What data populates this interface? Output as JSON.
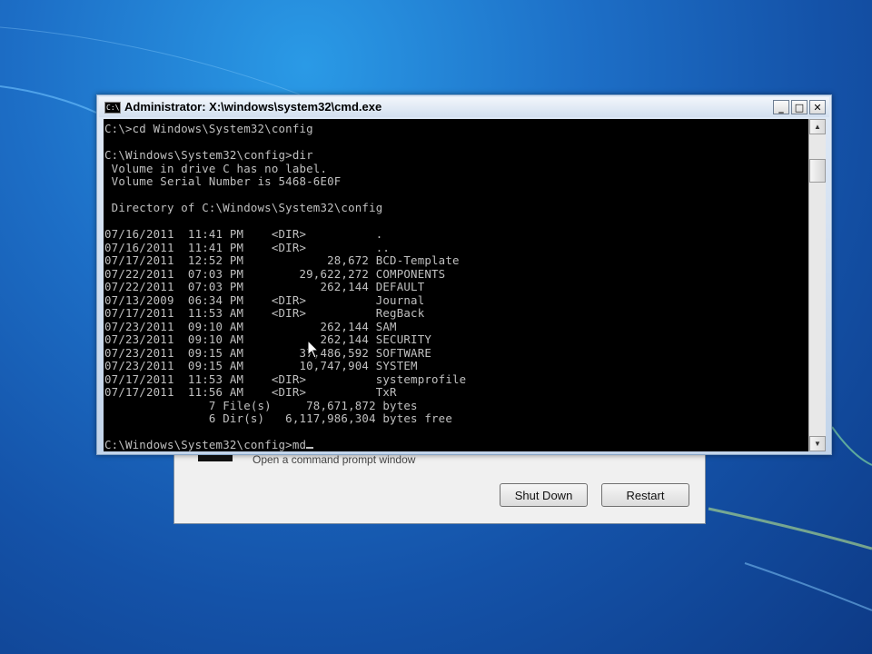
{
  "window": {
    "title": "Administrator: X:\\windows\\system32\\cmd.exe",
    "icon_label": "C:\\",
    "controls": {
      "minimize": "_",
      "maximize": "□",
      "close": "✕"
    }
  },
  "console": {
    "lines": [
      "C:\\>cd Windows\\System32\\config",
      "",
      "C:\\Windows\\System32\\config>dir",
      " Volume in drive C has no label.",
      " Volume Serial Number is 5468-6E0F",
      "",
      " Directory of C:\\Windows\\System32\\config",
      "",
      "07/16/2011  11:41 PM    <DIR>          .",
      "07/16/2011  11:41 PM    <DIR>          ..",
      "07/17/2011  12:52 PM            28,672 BCD-Template",
      "07/22/2011  07:03 PM        29,622,272 COMPONENTS",
      "07/22/2011  07:03 PM           262,144 DEFAULT",
      "07/13/2009  06:34 PM    <DIR>          Journal",
      "07/17/2011  11:53 AM    <DIR>          RegBack",
      "07/23/2011  09:10 AM           262,144 SAM",
      "07/23/2011  09:10 AM           262,144 SECURITY",
      "07/23/2011  09:15 AM        37,486,592 SOFTWARE",
      "07/23/2011  09:15 AM        10,747,904 SYSTEM",
      "07/17/2011  11:53 AM    <DIR>          systemprofile",
      "07/17/2011  11:56 AM    <DIR>          TxR",
      "               7 File(s)     78,671,872 bytes",
      "               6 Dir(s)   6,117,986,304 bytes free",
      ""
    ],
    "prompt": "C:\\Windows\\System32\\config>md"
  },
  "recovery_dialog": {
    "description": "Open a command prompt window",
    "shutdown_label": "Shut Down",
    "restart_label": "Restart"
  },
  "colors": {
    "console_bg": "#000000",
    "console_text": "#c0c0c0",
    "desktop_blue": "#1d6fc7"
  }
}
